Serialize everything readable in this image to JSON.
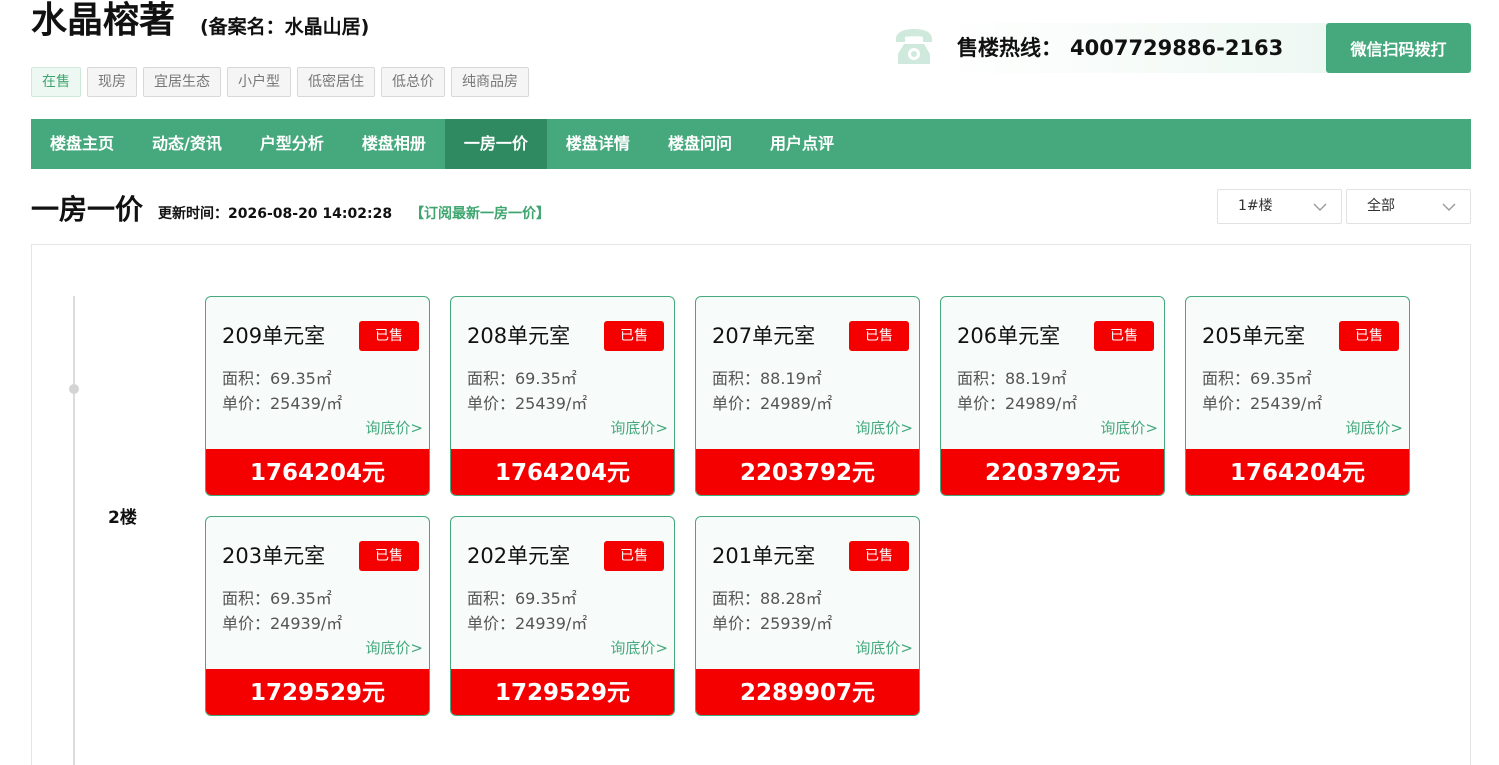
{
  "project": {
    "name": "水晶榕著",
    "record_name": "(备案名：水晶山居)"
  },
  "tags": [
    "在售",
    "现房",
    "宜居生态",
    "小户型",
    "低密居住",
    "低总价",
    "纯商品房"
  ],
  "hotline": {
    "icon": "phone-icon",
    "label": "售楼热线：",
    "number": "4007729886-2163",
    "button": "微信扫码拨打"
  },
  "nav": {
    "items": [
      "楼盘主页",
      "动态/资讯",
      "户型分析",
      "楼盘相册",
      "一房一价",
      "楼盘详情",
      "楼盘问问",
      "用户点评"
    ],
    "active": "一房一价"
  },
  "section": {
    "title": "一房一价",
    "update_label": "更新时间：",
    "update_time": "2026-08-20 14:02:28",
    "subscribe": "【订阅最新一房一价】"
  },
  "filters": {
    "building": "1#楼",
    "status": "全部"
  },
  "floor": {
    "label": "2楼"
  },
  "units": [
    {
      "name": "209单元室",
      "status": "已售",
      "area": "面积：69.35㎡",
      "unit_price": "单价：25439/㎡",
      "inquire": "询底价>",
      "total": "1764204元"
    },
    {
      "name": "208单元室",
      "status": "已售",
      "area": "面积：69.35㎡",
      "unit_price": "单价：25439/㎡",
      "inquire": "询底价>",
      "total": "1764204元"
    },
    {
      "name": "207单元室",
      "status": "已售",
      "area": "面积：88.19㎡",
      "unit_price": "单价：24989/㎡",
      "inquire": "询底价>",
      "total": "2203792元"
    },
    {
      "name": "206单元室",
      "status": "已售",
      "area": "面积：88.19㎡",
      "unit_price": "单价：24989/㎡",
      "inquire": "询底价>",
      "total": "2203792元"
    },
    {
      "name": "205单元室",
      "status": "已售",
      "area": "面积：69.35㎡",
      "unit_price": "单价：25439/㎡",
      "inquire": "询底价>",
      "total": "1764204元"
    },
    {
      "name": "203单元室",
      "status": "已售",
      "area": "面积：69.35㎡",
      "unit_price": "单价：24939/㎡",
      "inquire": "询底价>",
      "total": "1729529元"
    },
    {
      "name": "202单元室",
      "status": "已售",
      "area": "面积：69.35㎡",
      "unit_price": "单价：24939/㎡",
      "inquire": "询底价>",
      "total": "1729529元"
    },
    {
      "name": "201单元室",
      "status": "已售",
      "area": "面积：88.28㎡",
      "unit_price": "单价：25939/㎡",
      "inquire": "询底价>",
      "total": "2289907元"
    }
  ],
  "colors": {
    "brand_green": "#46a97e",
    "nav_active": "#2f8a62",
    "sold_red": "#f50000"
  }
}
